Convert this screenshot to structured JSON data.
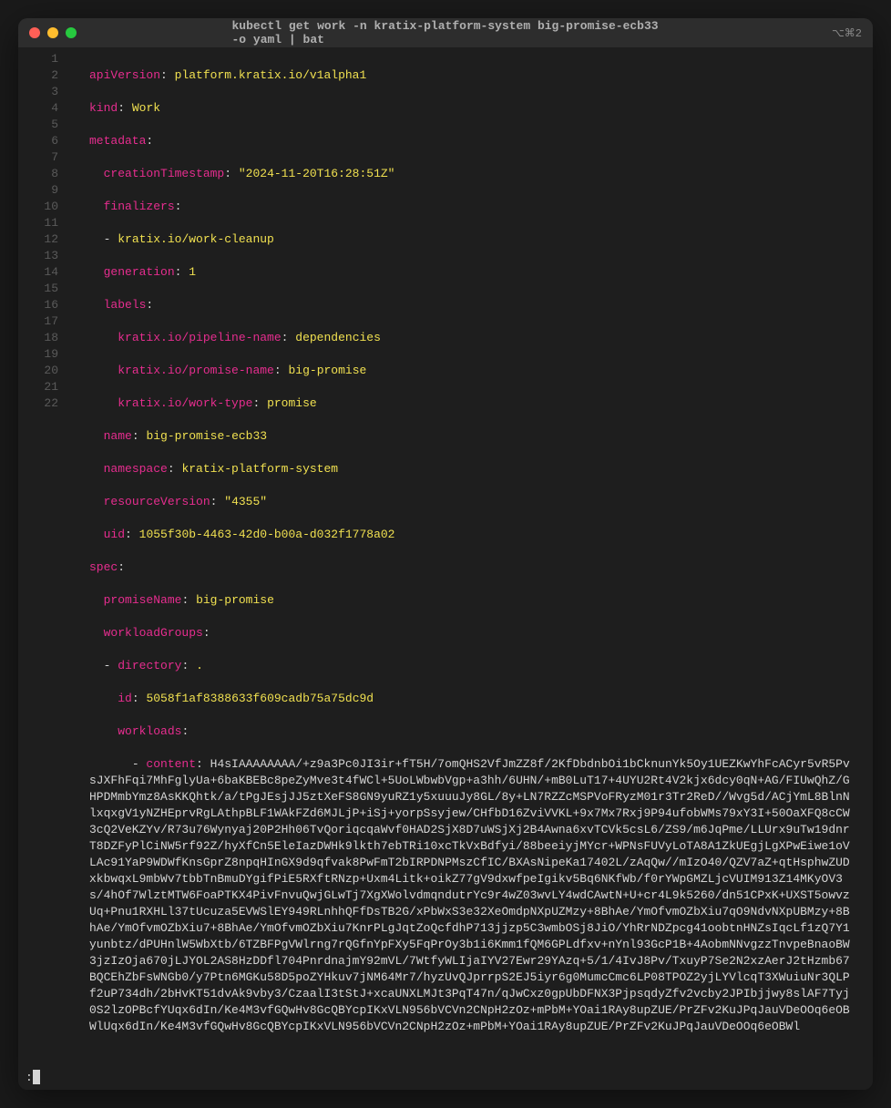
{
  "window": {
    "title": "kubectl get work -n kratix-platform-system big-promise-ecb33 -o yaml | bat",
    "rightStatus": "⌥⌘2"
  },
  "lineNumbers": [
    "1",
    "2",
    "3",
    "4",
    "5",
    "6",
    "7",
    "8",
    "9",
    "10",
    "11",
    "12",
    "13",
    "14",
    "15",
    "16",
    "17",
    "18",
    "19",
    "20",
    "21",
    "22"
  ],
  "lines": {
    "l1": {
      "key": "apiVersion",
      "val": "platform.kratix.io/v1alpha1"
    },
    "l2": {
      "key": "kind",
      "val": "Work"
    },
    "l3": {
      "key": "metadata"
    },
    "l4": {
      "key": "creationTimestamp",
      "val": "\"2024-11-20T16:28:51Z\""
    },
    "l5": {
      "key": "finalizers"
    },
    "l6": {
      "val": "kratix.io/work-cleanup"
    },
    "l7": {
      "key": "generation",
      "val": "1"
    },
    "l8": {
      "key": "labels"
    },
    "l9": {
      "key": "kratix.io/pipeline-name",
      "val": "dependencies"
    },
    "l10": {
      "key": "kratix.io/promise-name",
      "val": "big-promise"
    },
    "l11": {
      "key": "kratix.io/work-type",
      "val": "promise"
    },
    "l12": {
      "key": "name",
      "val": "big-promise-ecb33"
    },
    "l13": {
      "key": "namespace",
      "val": "kratix-platform-system"
    },
    "l14": {
      "key": "resourceVersion",
      "val": "\"4355\""
    },
    "l15": {
      "key": "uid",
      "val": "1055f30b-4463-42d0-b00a-d032f1778a02"
    },
    "l16": {
      "key": "spec"
    },
    "l17": {
      "key": "promiseName",
      "val": "big-promise"
    },
    "l18": {
      "key": "workloadGroups"
    },
    "l19": {
      "key": "directory",
      "val": "."
    },
    "l20": {
      "key": "id",
      "val": "5058f1af8388633f609cadb75a75dc9d"
    },
    "l21": {
      "key": "workloads"
    }
  },
  "contentKey": "content",
  "contentLabelPrefix": "      - ",
  "contentBlob": "H4sIAAAAAAAA/+z9a3Pc0JI3ir+fT5H/7omQHS2VfJmZZ8f/2KfDbdnbOi1bCknunYk5Oy1UEZKwYhFcACyr5vR5PvsJXFhFqi7MhFglyUa+6baKBEBc8peZyMve3t4fWCl+5UoLWbwbVgp+a3hh/6UHN/+mB0LuT17+4UYU2Rt4V2kjx6dcy0qN+AG/FIUwQhZ/GHPDMmbYmz8AsKKQhtk/a/tPgJEsjJJ5ztXeFS8GN9yuRZ1y5xuuuJy8GL/8y+LN7RZZcMSPVoFRyzM01r3Tr2ReD//Wvg5d/ACjYmL8BlnNlxqxgV1yNZHEprvRgLAthpBLF1WAkFZd6MJLjP+iSj+yorpSsyjew/CHfbD16ZviVVKL+9x7Mx7Rxj9P94ufobWMs79xY3I+50OaXFQ8cCW3cQ2VeKZYv/R73u76Wynyaj20P2Hh06TvQoriqcqaWvf0HAD2SjX8D7uWSjXj2B4Awna6xvTCVk5csL6/ZS9/m6JqPme/LLUrx9uTw19dnrT8DZFyPlCiNW5rf92Z/hyXfCn5EleIazDWHk9lkth7ebTRi10xcTkVxBdfyi/88beeiyjMYcr+WPNsFUVyLoTA8A1ZkUEgjLgXPwEiwe1oVLAc91YaP9WDWfKnsGprZ8npqHInGX9d9qfvak8PwFmT2bIRPDNPMszCfIC/BXAsNipeKa17402L/zAqQw//mIzO40/QZV7aZ+qtHsphwZUDxkbwqxL9mbWv7tbbTnBmuDYgifPiE5RXftRNzp+Uxm4Litk+oikZ77gV9dxwfpeIgikv5Bq6NKfWb/f0rYWpGMZLjcVUIM913Z14MKyOV3s/4hOf7WlztMTW6FoaPTKX4PivFnvuQwjGLwTj7XgXWolvdmqndutrYc9r4wZ03wvLY4wdCAwtN+U+cr4L9k5260/dn51CPxK+UXST5owvzUq+Pnu1RXHLl37tUcuza5EVWSlEY949RLnhhQFfDsTB2G/xPbWxS3e32XeOmdpNXpUZMzy+8BhAe/YmOfvmOZbXiu7qO9NdvNXpUBMzy+8BhAe/YmOfvmOZbXiu7+8BhAe/YmOfvmOZbXiu7KnrPLgJqtZoQcfdhP713jjzp5C3wmbOSj8JiO/YhRrNDZpcg41oobtnHNZsIqcLf1zQ7Y1yunbtz/dPUHnlW5WbXtb/6TZBFPgVWlrng7rQGfnYpFXy5FqPrOy3b1i6Kmm1fQM6GPLdfxv+nYnl93GcP1B+4AobmNNvgzzTnvpeBnaoBW3jzIzOja670jLJYOL2AS8HzDDfl704PnrdnajmY92mVL/7WtfyWLIjaIYV27Ewr29YAzq+5/1/4IvJ8Pv/TxuyP7Se2N2xzAerJ2tHzmb67BQCEhZbFsWNGb0/y7Ptn6MGKu58D5poZYHkuv7jNM64Mr7/hyzUvQJprrpS2EJ5iyr6g0MumcCmc6LP08TPOZ2yjLYVlcqT3XWuiuNr3QLPf2uP734dh/2bHvKT51dvAk9vby3/CzaalI3tStJ+xcaUNXLMJt3PqT47n/qJwCxz0gpUbDFNX3PjpsqdyZfv2vcby2JPIbjjwy8slAF7Tyj0S2lzOPBcfYUqx6dIn/Ke4M3vfGQwHv8GcQBYcpIKxVLN956bVCVn2CNpH2zOz+mPbM+YOai1RAy8upZUE/PrZFv2KuJPqJauVDeOOq6eOBWlUqx6dIn/Ke4M3vfGQwHv8GcQBYcpIKxVLN956bVCVn2CNpH2zOz+mPbM+YOai1RAy8upZUE/PrZFv2KuJPqJauVDeOOq6eOBWl",
  "pagerPrompt": ":"
}
